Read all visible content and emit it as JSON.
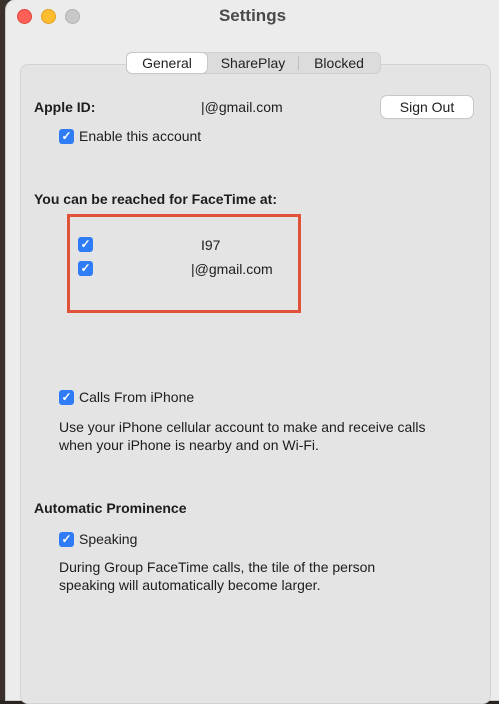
{
  "window": {
    "title": "Settings"
  },
  "tabs": [
    {
      "label": "General",
      "selected": true
    },
    {
      "label": "SharePlay",
      "selected": false
    },
    {
      "label": "Blocked",
      "selected": false
    }
  ],
  "apple_id": {
    "label": "Apple ID:",
    "value": "|@gmail.com",
    "sign_out_label": "Sign Out",
    "enable_label": "Enable this account",
    "enable_checked": true
  },
  "reach": {
    "heading": "You can be reached for FaceTime at:",
    "items": [
      {
        "value": "I97",
        "checked": true
      },
      {
        "value": "|@gmail.com",
        "checked": true
      }
    ]
  },
  "calls": {
    "label": "Calls From iPhone",
    "checked": true,
    "description_line1": "Use your iPhone cellular account to make and receive calls",
    "description_line2": "when your iPhone is nearby and on Wi-Fi."
  },
  "prominence": {
    "heading": "Automatic Prominence",
    "speaking_label": "Speaking",
    "speaking_checked": true,
    "description_line1": "During Group FaceTime calls, the tile of the person",
    "description_line2": "speaking will automatically become larger."
  },
  "colors": {
    "accent": "#2f7cf6",
    "highlight": "#e0533a"
  }
}
